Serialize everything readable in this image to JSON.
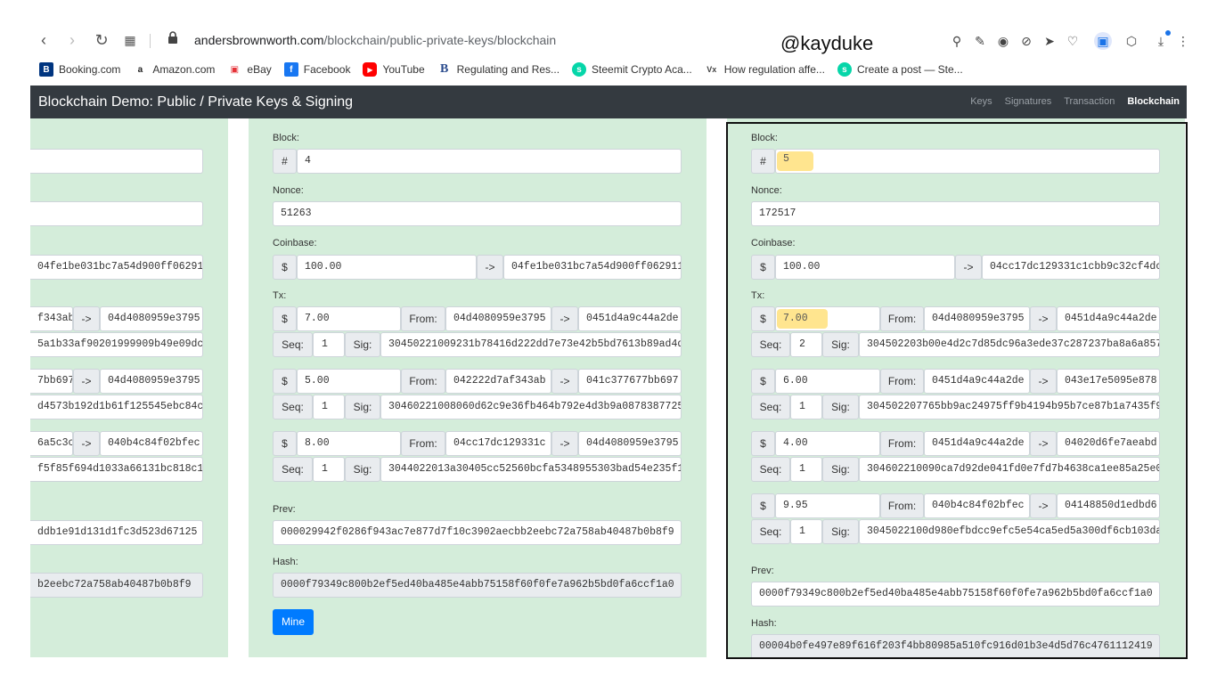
{
  "browser": {
    "url_host": "andersbrownworth.com",
    "url_path": "/blockchain/public-private-keys/blockchain",
    "bookmarks": [
      {
        "label": "Booking.com",
        "icon": "booking-icon",
        "color": "#003580",
        "glyph": "B"
      },
      {
        "label": "Amazon.com",
        "icon": "amazon-icon",
        "color": "#222222",
        "glyph": "a"
      },
      {
        "label": "eBay",
        "icon": "ebay-icon",
        "color": "#e53238",
        "glyph": "e"
      },
      {
        "label": "Facebook",
        "icon": "facebook-icon",
        "color": "#1877f2",
        "glyph": "f"
      },
      {
        "label": "YouTube",
        "icon": "youtube-icon",
        "color": "#ff0000",
        "glyph": "▶"
      },
      {
        "label": "Regulating and Res...",
        "icon": "b-icon",
        "color": "#2a4b8d",
        "glyph": "B"
      },
      {
        "label": "Steemit Crypto Aca...",
        "icon": "steemit-icon",
        "color": "#06d6a9",
        "glyph": "s"
      },
      {
        "label": "How regulation affe...",
        "icon": "vox-icon",
        "color": "#444444",
        "glyph": "V"
      },
      {
        "label": "Create a post — Ste...",
        "icon": "steemit-icon",
        "color": "#06d6a9",
        "glyph": "s"
      }
    ]
  },
  "overlay_text": "@kayduke",
  "app": {
    "title": "Blockchain Demo: Public / Private Keys & Signing",
    "nav": [
      "Keys",
      "Signatures",
      "Transaction",
      "Blockchain"
    ]
  },
  "labels": {
    "block": "Block:",
    "nonce": "Nonce:",
    "coinbase": "Coinbase:",
    "tx": "Tx:",
    "prev": "Prev:",
    "hash": "Hash:",
    "from": "From:",
    "seq": "Seq:",
    "sig": "Sig:",
    "hash_sym": "#",
    "dollar": "$",
    "arrow": "->",
    "mine": "Mine"
  },
  "left_block": {
    "coinbase_to": "04fe1be031bc7a54d900ff062911",
    "txs": [
      {
        "from": "f343ab",
        "to": "04d4080959e3795",
        "sig": "5a1b33af90201999909b49e09dc5"
      },
      {
        "from": "7bb697",
        "to": "04d4080959e3795",
        "sig": "d4573b192d1b61f125545ebc84c5l"
      },
      {
        "from": "6a5c3c",
        "to": "040b4c84f02bfec",
        "sig": "f5f85f694d1033a66131bc818c18"
      }
    ],
    "prev": "ddb1e91d131d1fc3d523d67125",
    "hash": "b2eebc72a758ab40487b0b8f9"
  },
  "middle_block": {
    "block": "4",
    "nonce": "51263",
    "coinbase_value": "100.00",
    "coinbase_to": "04fe1be031bc7a54d900ff062911",
    "txs": [
      {
        "value": "7.00",
        "from": "04d4080959e3795",
        "to": "0451d4a9c44a2de",
        "seq": "1",
        "sig": "30450221009231b78416d222dd7e73e42b5bd7613b89ad4d"
      },
      {
        "value": "5.00",
        "from": "042222d7af343ab",
        "to": "041c377677bb697",
        "seq": "1",
        "sig": "30460221008060d62c9e36fb464b792e4d3b9a0878387725"
      },
      {
        "value": "8.00",
        "from": "04cc17dc129331c",
        "to": "04d4080959e3795",
        "seq": "1",
        "sig": "3044022013a30405cc52560bcfa5348955303bad54e235f1"
      }
    ],
    "prev": "000029942f0286f943ac7e877d7f10c3902aecbb2eebc72a758ab40487b0b8f9",
    "hash": "0000f79349c800b2ef5ed40ba485e4abb75158f60f0fe7a962b5bd0fa6ccf1a0"
  },
  "right_block": {
    "block": "5",
    "nonce": "172517",
    "coinbase_value": "100.00",
    "coinbase_to": "04cc17dc129331c1cbb9c32cf4dc",
    "txs": [
      {
        "value": "7.00",
        "from": "04d4080959e3795",
        "to": "0451d4a9c44a2de",
        "seq": "2",
        "sig": "304502203b00e4d2c7d85dc96a3ede37c287237ba8a6a857"
      },
      {
        "value": "6.00",
        "from": "0451d4a9c44a2de",
        "to": "043e17e5095e878",
        "seq": "1",
        "sig": "304502207765bb9ac24975ff9b4194b95b7ce87b1a7435f9"
      },
      {
        "value": "4.00",
        "from": "0451d4a9c44a2de",
        "to": "04020d6fe7aeabd",
        "seq": "1",
        "sig": "304602210090ca7d92de041fd0e7fd7b4638ca1ee85a25e0"
      },
      {
        "value": "9.95",
        "from": "040b4c84f02bfec",
        "to": "04148850d1edbd6",
        "seq": "1",
        "sig": "3045022100d980efbdcc9efc5e54ca5ed5a300df6cb103da"
      }
    ],
    "prev": "0000f79349c800b2ef5ed40ba485e4abb75158f60f0fe7a962b5bd0fa6ccf1a0",
    "hash": "00004b0fe497e89f616f203f4bb80985a510fc916d01b3e4d5d76c4761112419"
  },
  "colors": {
    "card": "#d4edda",
    "navbar": "#343a40",
    "highlight": "#ffe58f",
    "mine_button": "#007bff"
  }
}
